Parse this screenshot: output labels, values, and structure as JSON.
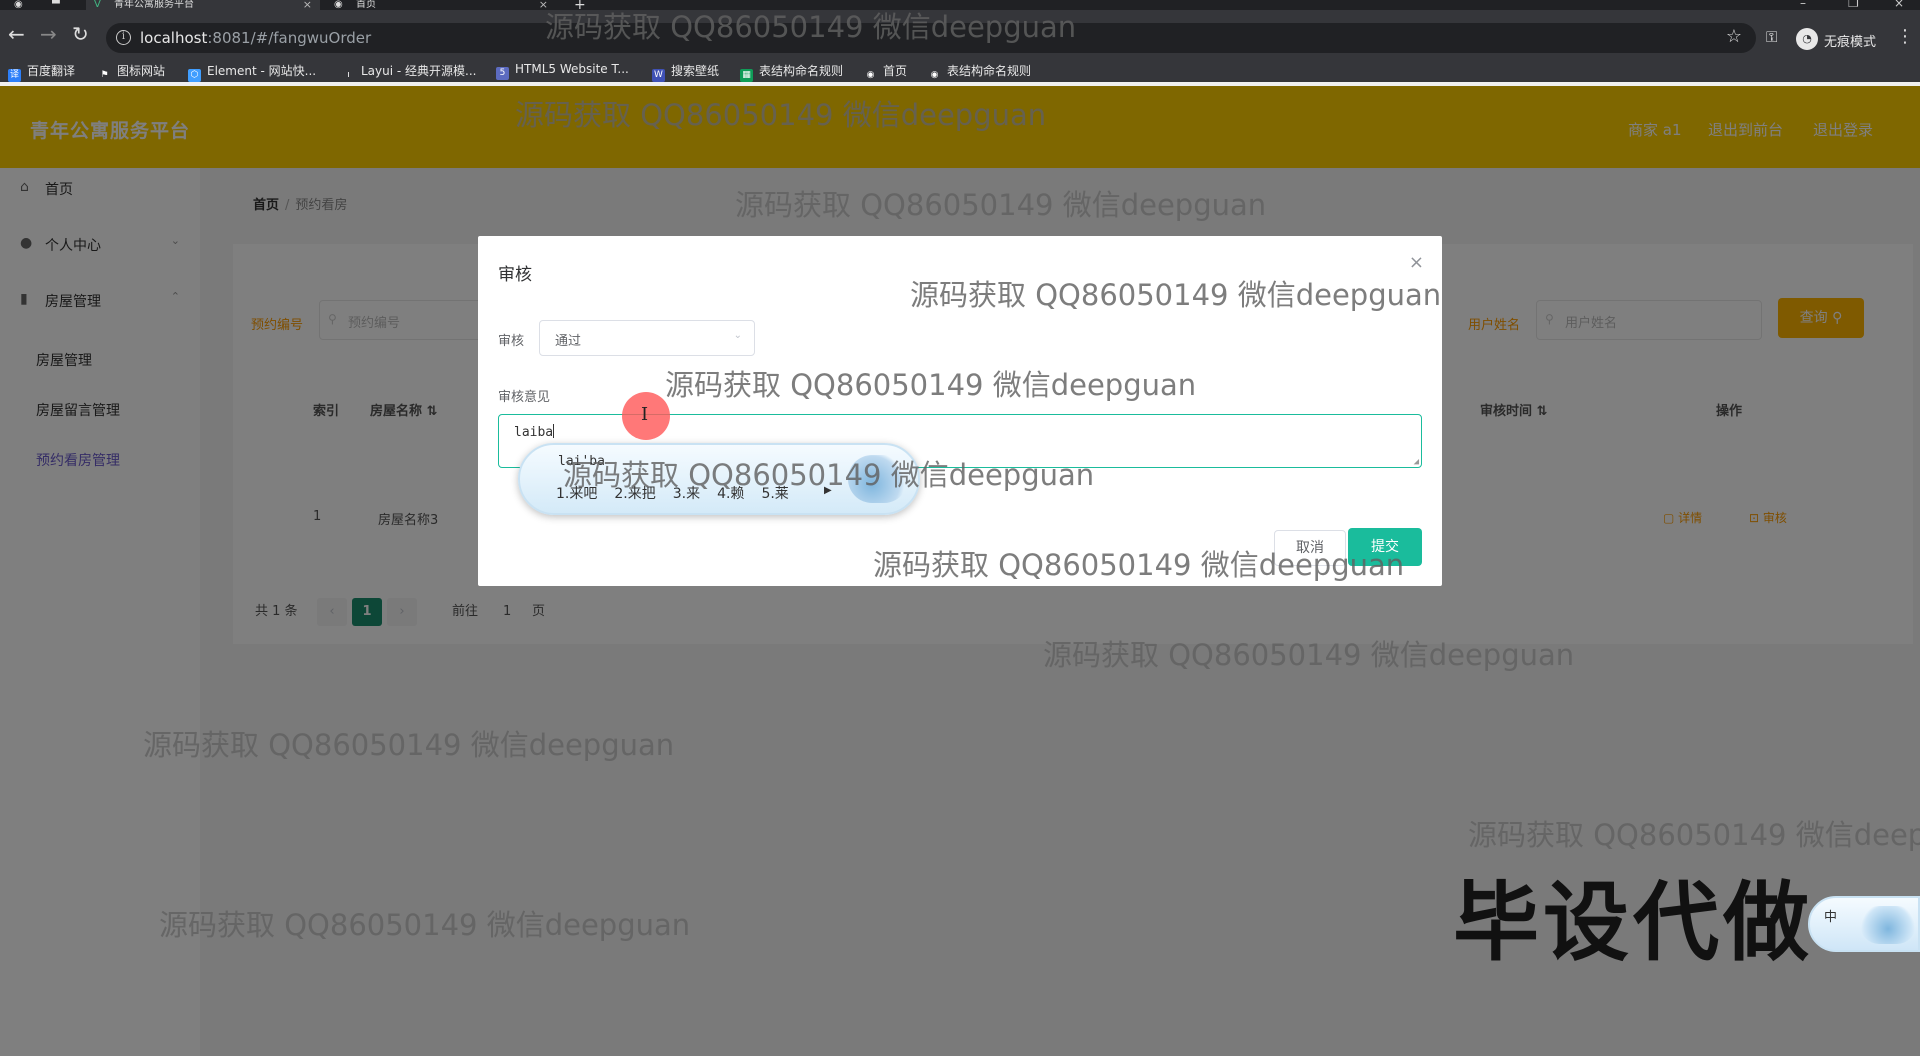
{
  "browser": {
    "tabs": [
      {
        "title": "青年公寓服务平台",
        "active": true
      },
      {
        "title": "首页",
        "active": false
      }
    ],
    "new_tab_label": "+",
    "url_host": "localhost",
    "url_rest": ":8081/#/fangwuOrder",
    "profile_name": "无痕模式",
    "bookmarks": [
      "百度翻译",
      "图标网站",
      "Element - 网站快...",
      "Layui - 经典开源模...",
      "HTML5 Website T...",
      "搜索壁纸",
      "表结构命名规则",
      "首页",
      "表结构命名规则"
    ]
  },
  "app": {
    "title": "青年公寓服务平台",
    "header_links": [
      "商家 a1",
      "退出到前台",
      "退出登录"
    ],
    "sidebar": [
      {
        "label": "首页",
        "icon": "home-icon"
      },
      {
        "label": "个人中心",
        "icon": "user-icon"
      },
      {
        "label": "房屋管理",
        "icon": "chart-icon"
      }
    ],
    "sidebar_sub": [
      "房屋管理",
      "房屋留言管理",
      "预约看房管理"
    ],
    "breadcrumb": {
      "home": "首页",
      "sep": "/",
      "current": "预约看房"
    },
    "search": {
      "order_label": "预约编号",
      "order_placeholder": "预约编号",
      "user_label": "用户姓名",
      "user_placeholder": "用户姓名",
      "query_button": "查询"
    },
    "table": {
      "columns": [
        "索引",
        "房屋名称",
        "审核时间",
        "操作"
      ],
      "rows": [
        {
          "index": "1",
          "name": "房屋名称3",
          "actions": [
            "详情",
            "审核"
          ]
        }
      ]
    },
    "pagination": {
      "total": "共 1 条",
      "current_page": "1",
      "goto_label": "前往",
      "goto_value": "1",
      "page_suffix": "页"
    }
  },
  "dialog": {
    "title": "审核",
    "review_label": "审核",
    "review_value": "通过",
    "opinion_label": "审核意见",
    "opinion_value": "laiba",
    "cancel_label": "取消",
    "submit_label": "提交"
  },
  "ime": {
    "composition": "lai'ba",
    "candidates": [
      "1.来吧",
      "2.来把",
      "3.来",
      "4.赖",
      "5.莱"
    ],
    "status": "中"
  },
  "watermarks": {
    "text": "源码获取 QQ86050149 微信deepguan",
    "text_cut": "源码获取 QQ86050149 微信deep",
    "big": "毕设代做"
  }
}
